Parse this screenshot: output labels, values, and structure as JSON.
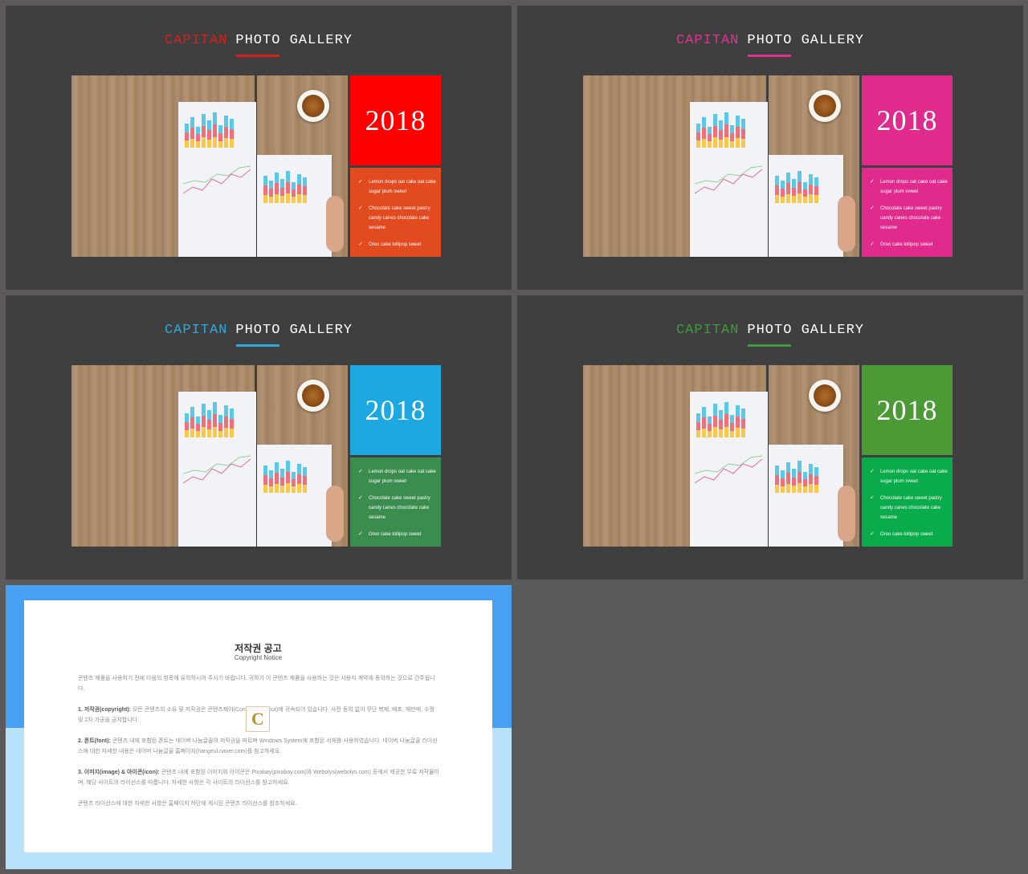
{
  "slides": [
    {
      "accent_word": "CAPITAN",
      "rest_title": "PHOTO GALLERY",
      "accent_color": "#d71f1f",
      "year": "2018",
      "year_bg": "#fe0000",
      "list_bg": "#e24a1f",
      "items": [
        "Lemon drops oat cake oat cake sugar plum sweet",
        "Chocolate cake sweet pastry candy canes chocolate cake sesame",
        "Oreo cake lollipop sweet"
      ]
    },
    {
      "accent_word": "CAPITAN",
      "rest_title": "PHOTO GALLERY",
      "accent_color": "#e0338f",
      "year": "2018",
      "year_bg": "#e02b8d",
      "list_bg": "#e02b8d",
      "items": [
        "Lemon drops oat cake oat cake sugar plum sweet",
        "Chocolate cake sweet pastry candy canes chocolate cake sesame",
        "Oreo cake lollipop sweet"
      ]
    },
    {
      "accent_word": "CAPITAN",
      "rest_title": "PHOTO GALLERY",
      "accent_color": "#2fa8df",
      "year": "2018",
      "year_bg": "#1ea8e2",
      "list_bg": "#3b8c4f",
      "items": [
        "Lemon drops oat cake oat cake sugar plum sweet",
        "Chocolate cake sweet pastry candy canes chocolate cake sesame",
        "Oreo cake lollipop sweet"
      ]
    },
    {
      "accent_word": "CAPITAN",
      "rest_title": "PHOTO GALLERY",
      "accent_color": "#3f9a3f",
      "year": "2018",
      "year_bg": "#4c9a36",
      "list_bg": "#0aab4a",
      "items": [
        "Lemon drops oat cake oat cake sugar plum sweet",
        "Chocolate cake sweet pastry candy canes chocolate cake sesame",
        "Oreo cake lollipop sweet"
      ]
    }
  ],
  "notice": {
    "title": "저작권 공고",
    "subtitle": "Copyright Notice",
    "intro": "콘텐츠 제품을 사용하기 전에 다음의 항목에 유의하시어 주시기 바랍니다. 귀하가 이 콘텐츠 제품을 사용하는 것은 사용자 계약에 동의하는 것으로 간주됩니다.",
    "p1_head": "1. 저작권(copyright):",
    "p1_text": "모든 콘텐츠의 소유 및 저작권은 콘텐츠제이(Contentstokeout)에 귀속되어 있습니다. 사전 동의 없이 무단 복제, 배포, 재판매, 수정 및 2차 가공을 금지합니다.",
    "p2_head": "2. 폰트(font):",
    "p2_text": "콘텐츠 내에 포함된 폰트는 네이버 나눔글꼴의 저작권을 따르며 Windows System에 포함된 서체를 사용하였습니다. 네이버 나눔글꼴 라이선스에 대한 자세한 내용은 네이버 나눔글꼴 홈페이지(hangeul.naver.com)를 참고하세요.",
    "p3_head": "3. 이미지(image) & 아이콘(icon):",
    "p3_text": "콘텐츠 내에 포함된 이미지와 아이콘은 Pixabay(pixabay.com)와 Webolys(webolys.com) 등에서 제공한 무료 저작물이며, 해당 사이트의 라이선스를 따릅니다. 자세한 사항은 각 사이트의 라이선스를 참고하세요.",
    "outro": "콘텐츠 라이선스에 대한 자세한 사항은 홈페이지 하단에 게시된 콘텐츠 라이선스를 참조하세요.",
    "logo_letter": "C"
  }
}
